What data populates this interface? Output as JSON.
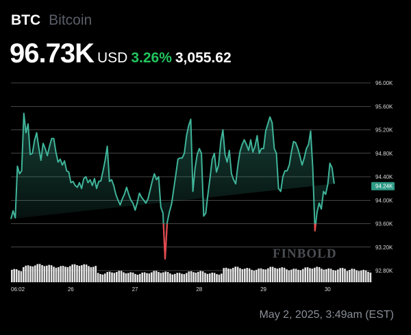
{
  "header": {
    "ticker": "BTC",
    "asset_name": "Bitcoin",
    "price": "96.73K",
    "currency": "USD",
    "change_pct": "3.26%",
    "change_abs": "3,055.62"
  },
  "footer": {
    "timestamp": "May 2, 2025, 3:49am (EST)"
  },
  "watermark": "FINBOLD",
  "colors": {
    "line": "#3fb59a",
    "line_negative": "#e5484d",
    "positive_text": "#22c55e",
    "volume_bar": "#e6e6e6",
    "grid": "#ffffff",
    "price_tag_bg": "#2e9a86"
  },
  "chart_data": {
    "type": "line",
    "series_name": "",
    "current_price_label": "94.24K",
    "current_price": 94.24,
    "ylim": [
      92.8,
      96.0
    ],
    "y_ticks": [
      "96.00K",
      "95.60K",
      "95.20K",
      "94.80K",
      "94.40K",
      "94.00K",
      "93.60K",
      "93.20K",
      "92.80K"
    ],
    "y_tick_values": [
      96.0,
      95.6,
      95.2,
      94.8,
      94.4,
      94.0,
      93.6,
      93.2,
      92.8
    ],
    "x_ticks": [
      "06:02",
      "26",
      "27",
      "28",
      "29",
      "30"
    ],
    "x_tick_positions": [
      0,
      13.25,
      28.25,
      43.25,
      58.25,
      73.25
    ],
    "xlim": [
      0,
      84
    ],
    "x": [
      0,
      0.5,
      1,
      1.5,
      2,
      2.5,
      3,
      3.5,
      4,
      4.5,
      5,
      5.5,
      6,
      6.5,
      7,
      7.5,
      8,
      8.5,
      9,
      9.5,
      10,
      10.5,
      11,
      11.5,
      12,
      12.5,
      13,
      13.5,
      14,
      14.5,
      15,
      15.5,
      16,
      16.5,
      17,
      17.5,
      18,
      18.5,
      19,
      19.5,
      20,
      20.5,
      21,
      21.5,
      22,
      22.5,
      23,
      23.5,
      24,
      24.5,
      25,
      25.5,
      26,
      26.5,
      27,
      27.5,
      28,
      28.5,
      29,
      29.5,
      30,
      30.5,
      31,
      31.5,
      32,
      32.5,
      33,
      33.5,
      34,
      34.5,
      35,
      35.5,
      36,
      36.5,
      37,
      37.5,
      38,
      38.5,
      39,
      39.5,
      40,
      40.5,
      41,
      41.5,
      42,
      42.5,
      43,
      43.5,
      44,
      44.5,
      45,
      45.5,
      46,
      46.5,
      47,
      47.5,
      48,
      48.5,
      49,
      49.5,
      50,
      50.5,
      51,
      51.5,
      52,
      52.5,
      53,
      53.5,
      54,
      54.5,
      55,
      55.5,
      56,
      56.5,
      57,
      57.5,
      58,
      58.5,
      59,
      59.5,
      60,
      60.5,
      61,
      61.5,
      62,
      62.5,
      63,
      63.5,
      64,
      64.5,
      65,
      65.5,
      66,
      66.5,
      67,
      67.5,
      68,
      68.5,
      69,
      69.5,
      70,
      70.5,
      71,
      71.5,
      72,
      72.5,
      73,
      73.5,
      74,
      74.5,
      75,
      75.5,
      76,
      76.5,
      77,
      77.5,
      78,
      78.5,
      79,
      79.5,
      80,
      80.5,
      81,
      81.5,
      82,
      82.5,
      83,
      83.5
    ],
    "values": [
      93.68,
      93.82,
      93.7,
      94.58,
      94.45,
      94.5,
      95.48,
      95.15,
      95.3,
      94.78,
      94.8,
      95.02,
      95.15,
      94.9,
      94.68,
      94.97,
      94.88,
      94.76,
      94.92,
      95.05,
      95.05,
      94.82,
      94.65,
      94.7,
      94.6,
      94.67,
      94.5,
      94.48,
      94.3,
      94.32,
      94.25,
      94.22,
      94.3,
      94.2,
      94.37,
      94.4,
      94.3,
      94.35,
      94.25,
      94.37,
      94.2,
      94.32,
      94.33,
      94.5,
      94.68,
      94.92,
      94.32,
      94.35,
      94.25,
      94.1,
      94.0,
      93.92,
      94.02,
      94.1,
      94.22,
      94.1,
      94.0,
      93.95,
      93.83,
      93.96,
      94.12,
      94.05,
      94.0,
      93.95,
      94.02,
      94.17,
      94.33,
      94.45,
      94.35,
      94.4,
      93.88,
      93.78,
      93.0,
      93.62,
      93.8,
      93.93,
      94.18,
      94.43,
      94.7,
      94.72,
      94.72,
      94.8,
      95.1,
      95.27,
      95.38,
      94.15,
      94.55,
      94.78,
      94.88,
      94.8,
      93.73,
      93.78,
      94.1,
      94.38,
      94.7,
      94.8,
      94.48,
      94.6,
      95.0,
      95.2,
      94.78,
      94.65,
      94.85,
      94.45,
      94.35,
      94.28,
      94.6,
      94.83,
      94.95,
      95.03,
      94.95,
      94.85,
      95.03,
      94.82,
      94.92,
      95.1,
      94.8,
      94.88,
      94.88,
      95.18,
      95.3,
      95.42,
      95.32,
      94.88,
      94.8,
      94.2,
      94.15,
      94.4,
      94.5,
      94.5,
      94.6,
      94.82,
      95.0,
      94.98,
      94.88,
      94.75,
      94.6,
      94.72,
      94.88,
      94.95,
      95.18,
      94.55,
      93.48,
      93.8,
      93.95,
      93.85,
      94.15,
      94.1,
      94.27,
      94.63,
      94.55,
      94.28
    ]
  }
}
